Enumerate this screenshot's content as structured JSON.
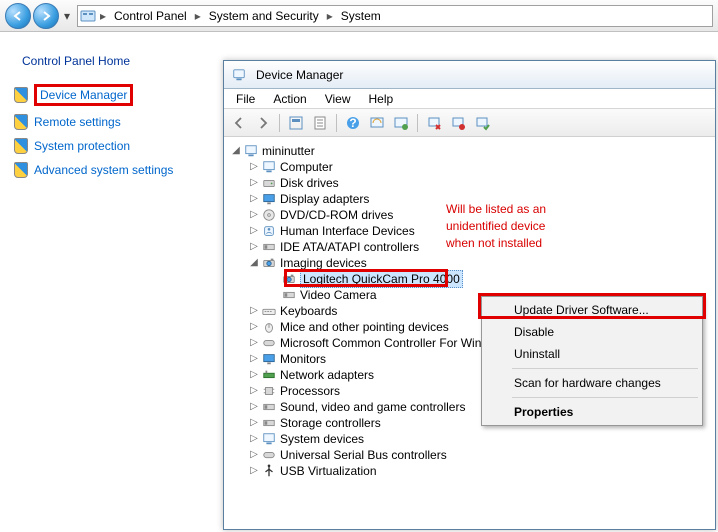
{
  "breadcrumbs": [
    "Control Panel",
    "System and Security",
    "System"
  ],
  "left_pane": {
    "home": "Control Panel Home",
    "links": [
      "Device Manager",
      "Remote settings",
      "System protection",
      "Advanced system settings"
    ]
  },
  "dm": {
    "title": "Device Manager",
    "menus": [
      "File",
      "Action",
      "View",
      "Help"
    ],
    "root": "mininutter",
    "categories": [
      {
        "label": "Computer",
        "expanded": false
      },
      {
        "label": "Disk drives",
        "expanded": false
      },
      {
        "label": "Display adapters",
        "expanded": false
      },
      {
        "label": "DVD/CD-ROM drives",
        "expanded": false
      },
      {
        "label": "Human Interface Devices",
        "expanded": false
      },
      {
        "label": "IDE ATA/ATAPI controllers",
        "expanded": false
      },
      {
        "label": "Imaging devices",
        "expanded": true,
        "children": [
          {
            "label": "Logitech QuickCam Pro 4000",
            "selected": true
          },
          {
            "label": "Video Camera",
            "selected": false
          }
        ]
      },
      {
        "label": "Keyboards",
        "expanded": false
      },
      {
        "label": "Mice and other pointing devices",
        "expanded": false
      },
      {
        "label": "Microsoft Common Controller For Windows Class",
        "expanded": false
      },
      {
        "label": "Monitors",
        "expanded": false
      },
      {
        "label": "Network adapters",
        "expanded": false
      },
      {
        "label": "Processors",
        "expanded": false
      },
      {
        "label": "Sound, video and game controllers",
        "expanded": false
      },
      {
        "label": "Storage controllers",
        "expanded": false
      },
      {
        "label": "System devices",
        "expanded": false
      },
      {
        "label": "Universal Serial Bus controllers",
        "expanded": false
      },
      {
        "label": "USB Virtualization",
        "expanded": false
      }
    ]
  },
  "annotation": {
    "line1": "Will be listed as an",
    "line2": "unidentified device",
    "line3": "when not installed"
  },
  "context_menu": {
    "items": [
      "Update Driver Software...",
      "Disable",
      "Uninstall",
      "Scan for hardware changes",
      "Properties"
    ]
  }
}
